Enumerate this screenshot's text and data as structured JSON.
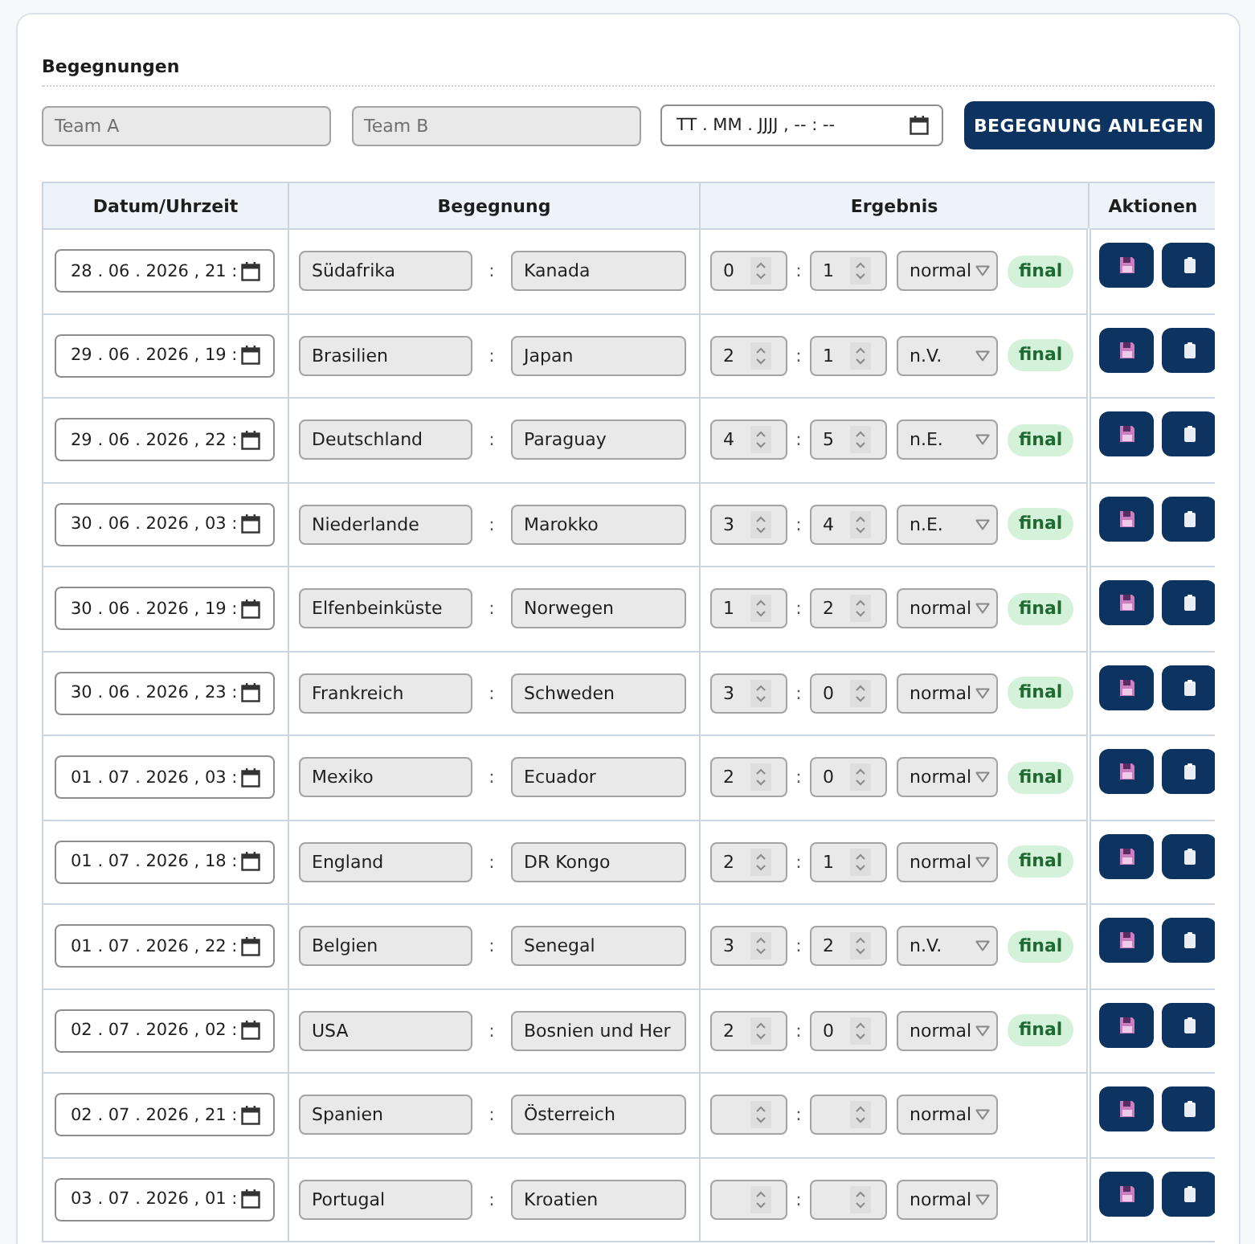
{
  "section": {
    "title": "Begegnungen"
  },
  "new_match_form": {
    "team_a": {
      "placeholder": "Team A"
    },
    "team_b": {
      "placeholder": "Team B"
    },
    "datetime": {
      "placeholder": "TT . MM . JJJJ , -- : --"
    },
    "submit_button": "BEGEGNUNG ANLEGEN"
  },
  "table": {
    "columns": [
      "Datum/Uhrzeit",
      "Begegnung",
      "Ergebnis",
      "Aktionen"
    ],
    "rows": [
      {
        "datetime": "28 . 06 . 2026 , 21 :",
        "team_a": "Südafrika",
        "separator": ":",
        "team_b": "Kanada",
        "score_a": "0",
        "score_separator": ":",
        "score_b": "1",
        "mode": "normal",
        "status": "final"
      },
      {
        "datetime": "29 . 06 . 2026 , 19 :",
        "team_a": "Brasilien",
        "separator": ":",
        "team_b": "Japan",
        "score_a": "2",
        "score_separator": ":",
        "score_b": "1",
        "mode": "n.V.",
        "status": "final"
      },
      {
        "datetime": "29 . 06 . 2026 , 22 :",
        "team_a": "Deutschland",
        "separator": ":",
        "team_b": "Paraguay",
        "score_a": "4",
        "score_separator": ":",
        "score_b": "5",
        "mode": "n.E.",
        "status": "final"
      },
      {
        "datetime": "30 . 06 . 2026 , 03 :",
        "team_a": "Niederlande",
        "separator": ":",
        "team_b": "Marokko",
        "score_a": "3",
        "score_separator": ":",
        "score_b": "4",
        "mode": "n.E.",
        "status": "final"
      },
      {
        "datetime": "30 . 06 . 2026 , 19 :",
        "team_a": "Elfenbeinküste",
        "separator": ":",
        "team_b": "Norwegen",
        "score_a": "1",
        "score_separator": ":",
        "score_b": "2",
        "mode": "normal",
        "status": "final"
      },
      {
        "datetime": "30 . 06 . 2026 , 23 :",
        "team_a": "Frankreich",
        "separator": ":",
        "team_b": "Schweden",
        "score_a": "3",
        "score_separator": ":",
        "score_b": "0",
        "mode": "normal",
        "status": "final"
      },
      {
        "datetime": "01 . 07 . 2026 , 03 :",
        "team_a": "Mexiko",
        "separator": ":",
        "team_b": "Ecuador",
        "score_a": "2",
        "score_separator": ":",
        "score_b": "0",
        "mode": "normal",
        "status": "final"
      },
      {
        "datetime": "01 . 07 . 2026 , 18 :",
        "team_a": "England",
        "separator": ":",
        "team_b": "DR Kongo",
        "score_a": "2",
        "score_separator": ":",
        "score_b": "1",
        "mode": "normal",
        "status": "final"
      },
      {
        "datetime": "01 . 07 . 2026 , 22 :",
        "team_a": "Belgien",
        "separator": ":",
        "team_b": "Senegal",
        "score_a": "3",
        "score_separator": ":",
        "score_b": "2",
        "mode": "n.V.",
        "status": "final"
      },
      {
        "datetime": "02 . 07 . 2026 , 02 :",
        "team_a": "USA",
        "separator": ":",
        "team_b": "Bosnien und Her",
        "score_a": "2",
        "score_separator": ":",
        "score_b": "0",
        "mode": "normal",
        "status": "final"
      },
      {
        "datetime": "02 . 07 . 2026 , 21 :",
        "team_a": "Spanien",
        "separator": ":",
        "team_b": "Österreich",
        "score_separator": ":",
        "mode": "normal"
      },
      {
        "datetime": "03 . 07 . 2026 , 01 :",
        "team_a": "Portugal",
        "separator": ":",
        "team_b": "Kroatien",
        "score_separator": ":",
        "mode": "normal"
      }
    ]
  }
}
